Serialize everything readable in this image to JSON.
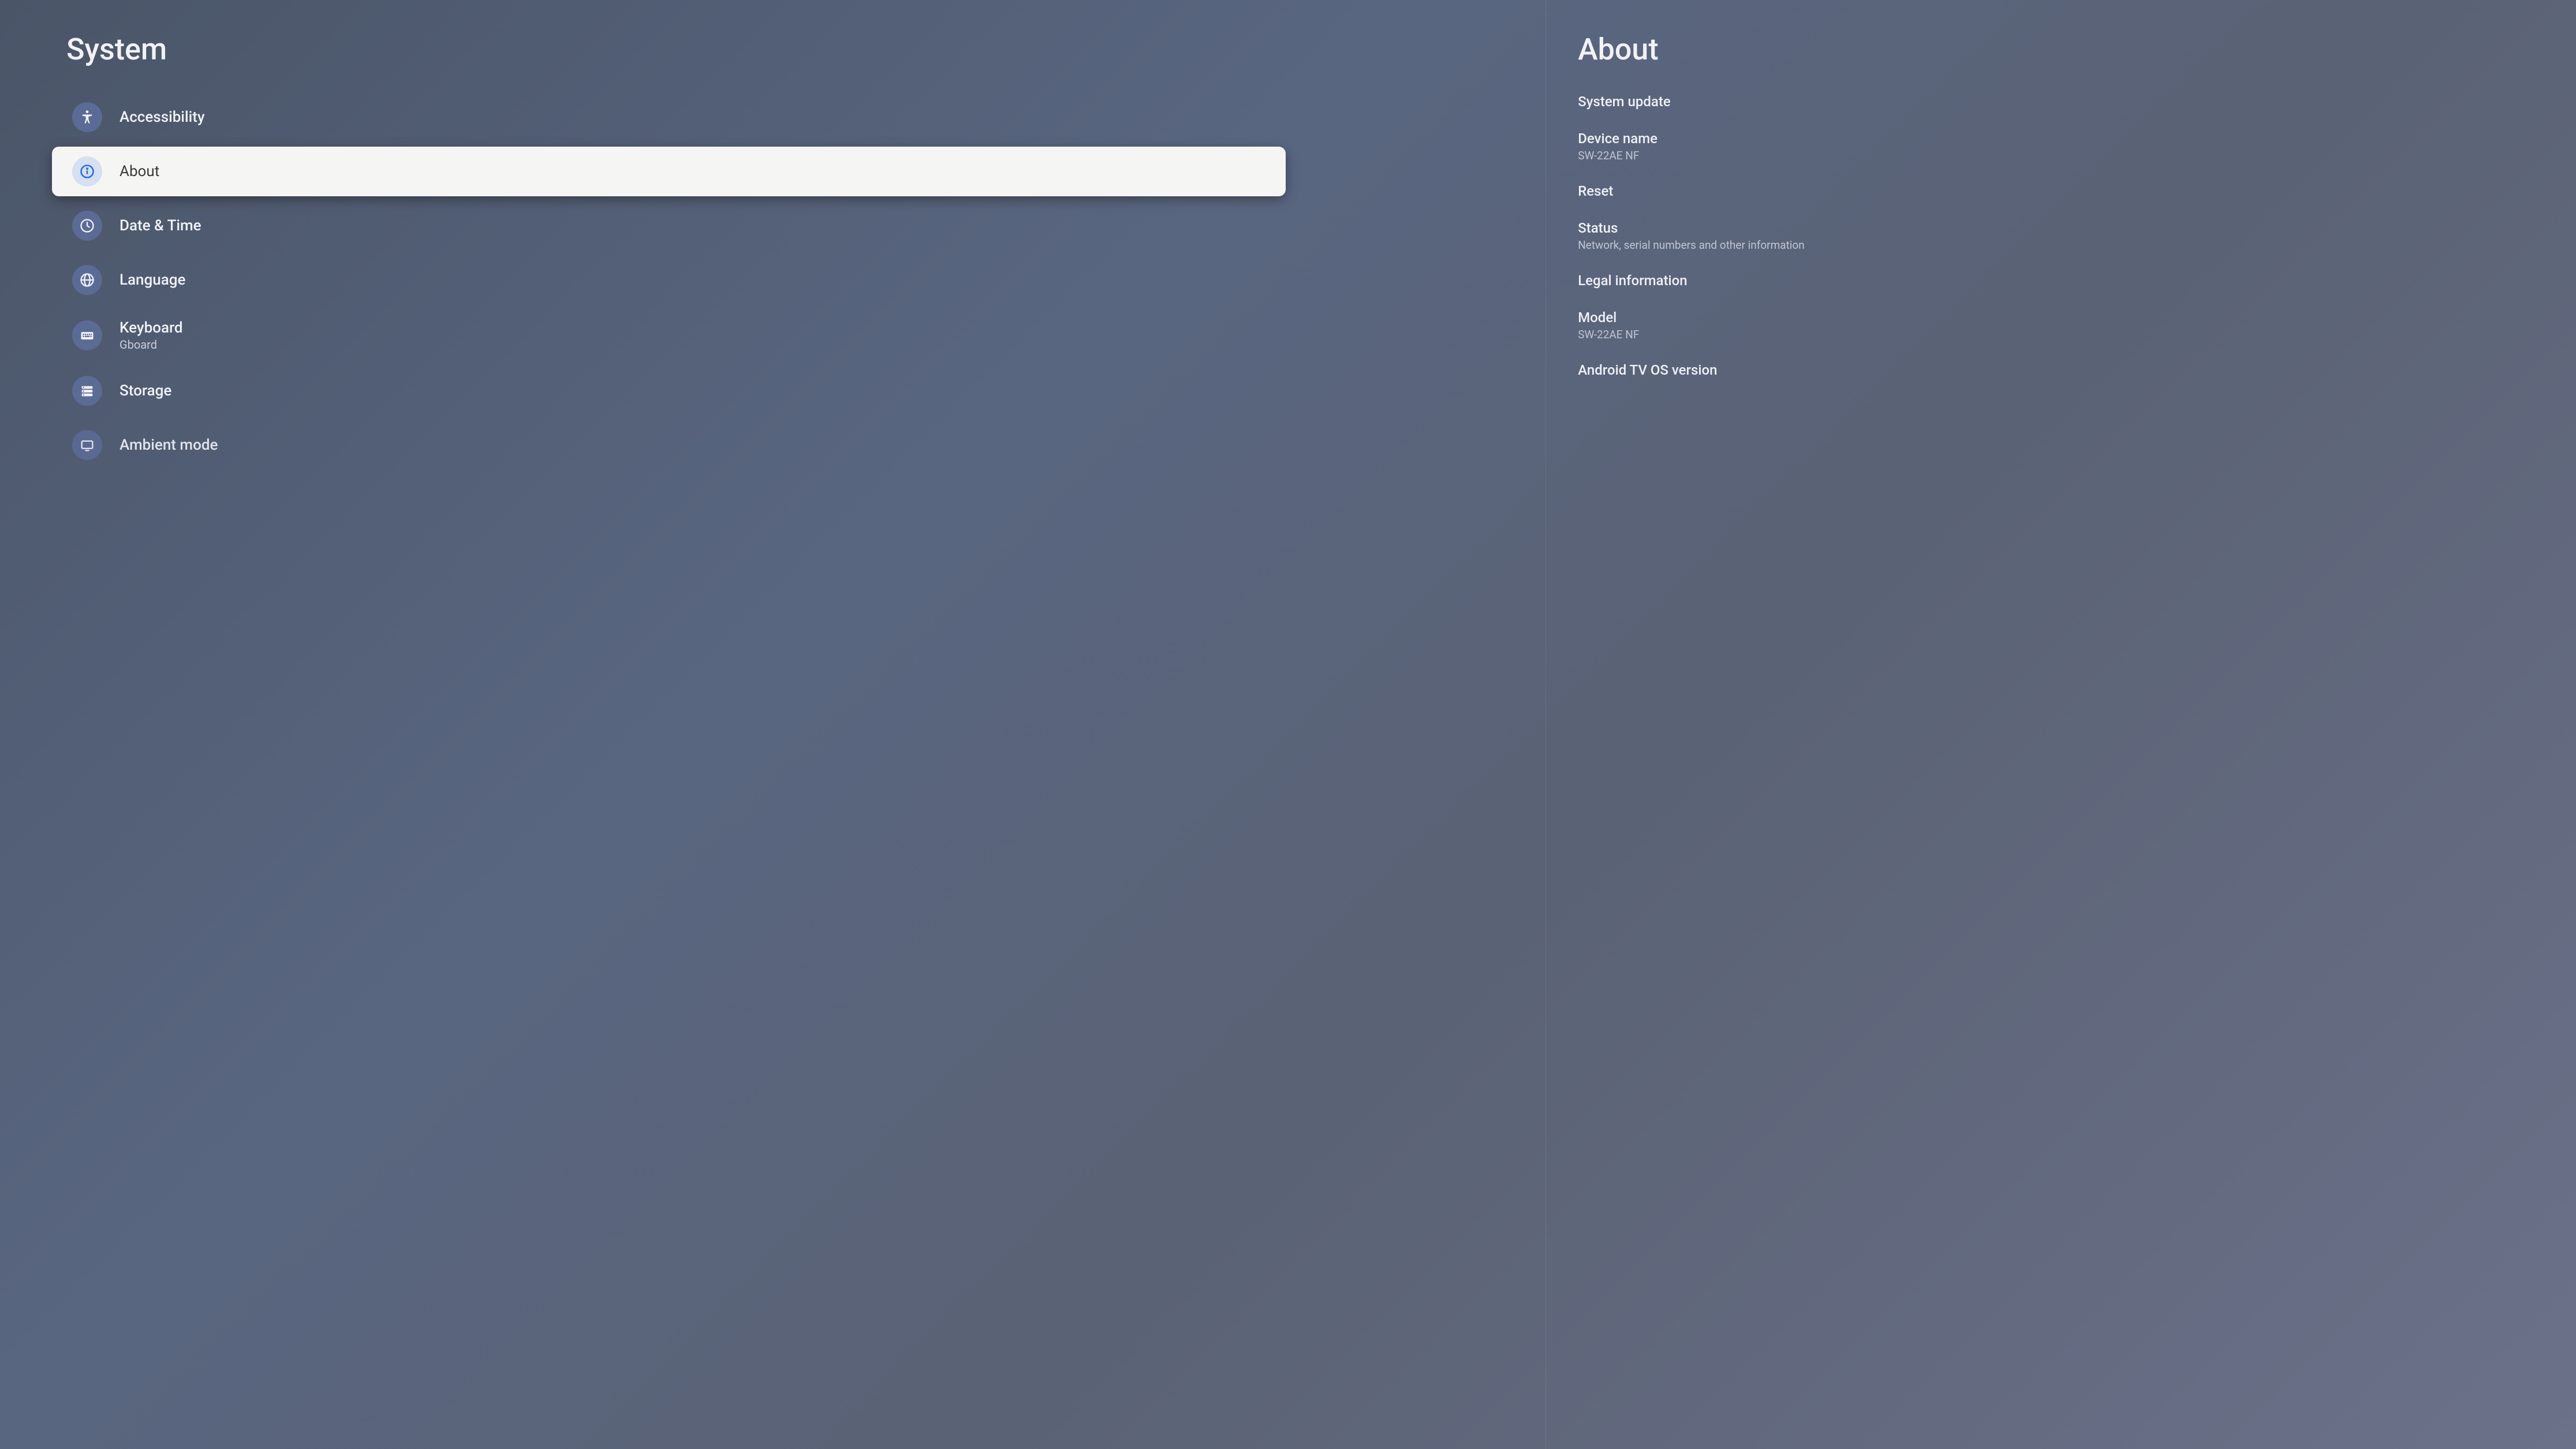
{
  "left": {
    "title": "System",
    "items": [
      {
        "label": "Accessibility",
        "icon": "accessibility-icon",
        "selected": false
      },
      {
        "label": "About",
        "icon": "info-icon",
        "selected": true
      },
      {
        "label": "Date & Time",
        "icon": "clock-icon",
        "selected": false
      },
      {
        "label": "Language",
        "icon": "globe-icon",
        "selected": false
      },
      {
        "label": "Keyboard",
        "sub": "Gboard",
        "icon": "keyboard-icon",
        "selected": false
      },
      {
        "label": "Storage",
        "icon": "storage-icon",
        "selected": false
      },
      {
        "label": "Ambient mode",
        "icon": "ambient-icon",
        "selected": false,
        "partial": true
      }
    ]
  },
  "right": {
    "title": "About",
    "items": [
      {
        "label": "System update"
      },
      {
        "label": "Device name",
        "sub": "SW-22AE NF"
      },
      {
        "label": "Reset"
      },
      {
        "label": "Status",
        "sub": "Network, serial numbers and other information"
      },
      {
        "label": "Legal information"
      },
      {
        "label": "Model",
        "sub": "SW-22AE NF"
      },
      {
        "label": "Android TV OS version"
      }
    ]
  }
}
